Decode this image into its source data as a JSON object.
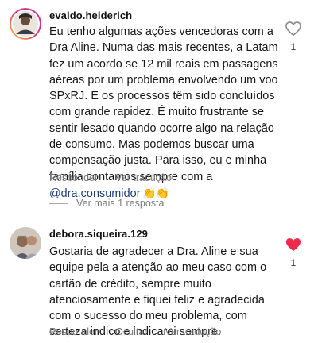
{
  "comments": [
    {
      "username": "evaldo.heiderich",
      "text_before_mention": "Eu tenho algumas ações vencedoras com a Dra Aline. Numa das mais recentes, a Latam fez um acordo se 12 mil reais em passagens aéreas por um problema envolvendo um voo  SPxRJ. E os processos têm sido concluídos com grande rapidez. É muito frustrante se sentir lesado quando ocorre algo na relação de consumo. Mas podemos buscar uma compensação justa. Para isso, eu e minha família contamos sempre com a ",
      "mention": "@dra.consumidor",
      "emoji": " 👏👏",
      "liked": false,
      "like_count": "1",
      "actions": {
        "reply": "Responder",
        "translate": "Ver tradução"
      },
      "view_replies": "Ver mais 1 resposta"
    },
    {
      "username": "debora.siqueira.129",
      "text": "Gostaria de agradecer a Dra. Aline e sua equipe pela a atenção ao meu caso com o cartão de crédito, sempre muito atenciosamente e fiquei feliz e agradecida com o sucesso do meu problema, com certeza indico e indicarei sempre.",
      "liked": true,
      "like_count": "1",
      "actions": {
        "reply": "Responder",
        "hide": "Ocultar",
        "translate": "Ver tradução"
      }
    }
  ],
  "colors": {
    "liked_heart": "#ed2a4b",
    "mention": "#1f3d7a",
    "secondary_text": "#7a7a7a"
  },
  "icons": {
    "like": "heart-icon"
  }
}
